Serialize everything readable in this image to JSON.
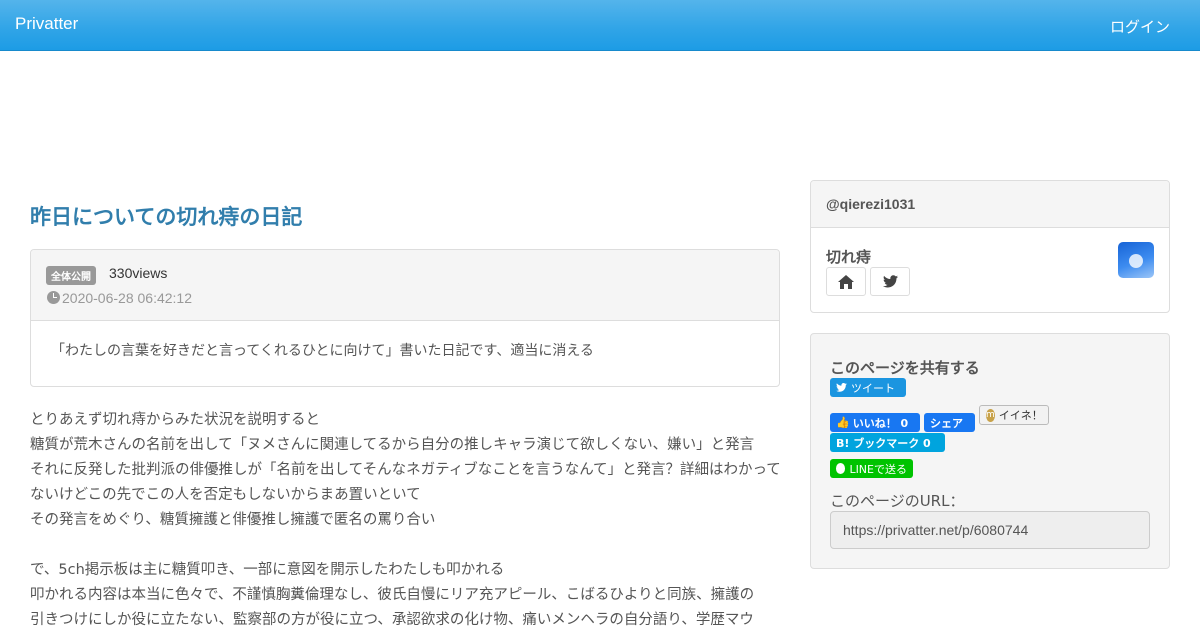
{
  "navbar": {
    "brand": "Privatter",
    "login": "ログイン"
  },
  "post": {
    "title": "昨日についての切れ痔の日記",
    "visibility_badge": "全体公開",
    "views": "330views",
    "date": "2020-06-28 06:42:12",
    "summary": "「わたしの言葉を好きだと言ってくれるひとに向けて」書いた日記です、適当に消える"
  },
  "body": {
    "lines": [
      "とりあえず切れ痔からみた状況を説明すると",
      "糖質が荒木さんの名前を出して「ヌメさんに関連してるから自分の推しキャラ演じて欲しくない、嫌い」と発言",
      "それに反発した批判派の俳優推しが「名前を出してそんなネガティブなことを言うなんて」と発言？詳細はわかってないけどこの先でこの人を否定もしないからまあ置いといて",
      "その発言をめぐり、糖質擁護と俳優推し擁護で匿名の罵り合い",
      "",
      "で、5ch掲示板は主に糖質叩き、一部に意図を開示したわたしも叩かれる",
      "叩かれる内容は本当に色々で、不謹慎胸糞倫理なし、彼氏自慢にリア充アピール、こばるひよりと同族、擁護の",
      "引きつけにしか役に立たない、監察部の方が役に立つ、承認欲求の化け物、痛いメンヘラの自分語り、学歴マウ"
    ]
  },
  "user": {
    "handle": "@qierezi1031",
    "name": "切れ痔",
    "icons": [
      "home-icon",
      "twitter-icon"
    ]
  },
  "share": {
    "title": "このページを共有する",
    "tweet": "ツイート",
    "fb_like": "いいね！ 0",
    "fb_share": "シェア",
    "mixi": "イイネ！",
    "hatena": "B! ブックマーク  0",
    "line": "LINEで送る",
    "url_label": "このページのURL：",
    "url": "https://privatter.net/p/6080744"
  },
  "colors": {
    "navbar": "#2fa4e7",
    "title": "#317eac",
    "twitter": "#1b95e0",
    "facebook": "#1877f2",
    "hatena": "#00a4de",
    "line": "#00c300"
  }
}
